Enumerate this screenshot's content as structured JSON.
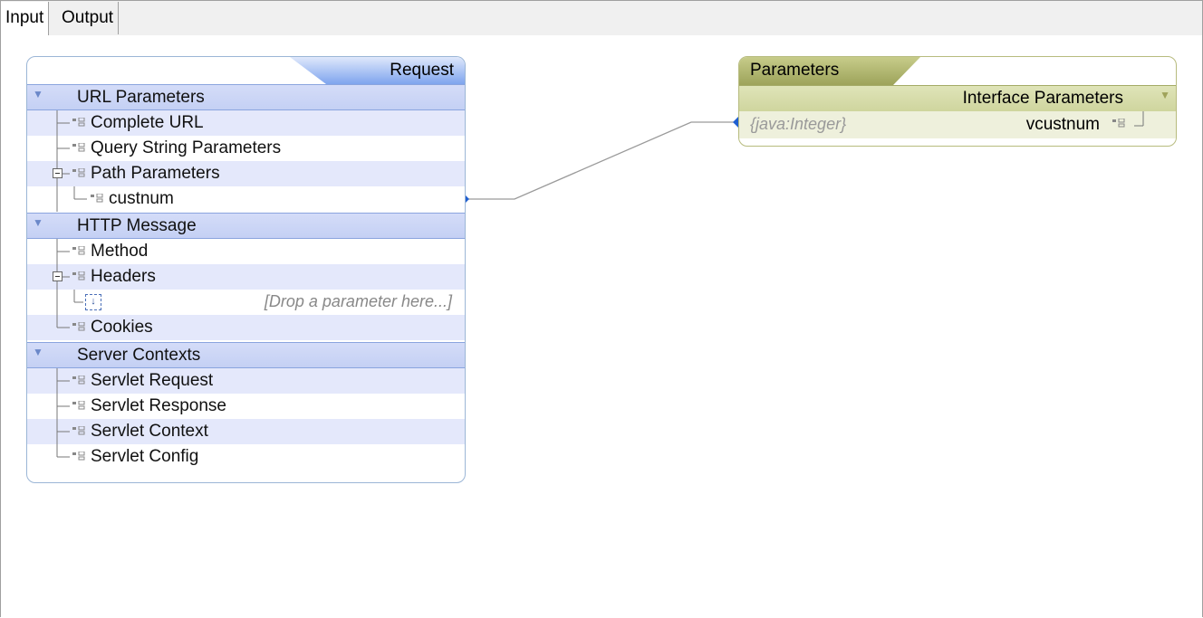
{
  "tabs": [
    {
      "label": "Input"
    },
    {
      "label": "Output"
    }
  ],
  "request": {
    "title": "Request",
    "sections": [
      {
        "label": "URL Parameters",
        "items": [
          {
            "label": "Complete URL"
          },
          {
            "label": "Query String Parameters"
          },
          {
            "label": "Path Parameters",
            "children": [
              {
                "label": "custnum"
              }
            ]
          }
        ]
      },
      {
        "label": "HTTP Message",
        "items": [
          {
            "label": "Method"
          },
          {
            "label": "Headers",
            "drop_hint": "[Drop a parameter here...]"
          },
          {
            "label": "Cookies"
          }
        ]
      },
      {
        "label": "Server Contexts",
        "items": [
          {
            "label": "Servlet Request"
          },
          {
            "label": "Servlet Response"
          },
          {
            "label": "Servlet Context"
          },
          {
            "label": "Servlet Config"
          }
        ]
      }
    ]
  },
  "parameters": {
    "title": "Parameters",
    "group_label": "Interface Parameters",
    "rows": [
      {
        "type": "{java:Integer}",
        "name": "vcustnum"
      }
    ]
  },
  "mapping": {
    "from": "custnum",
    "to": "vcustnum"
  },
  "colors": {
    "request_accent": "#2f6fd8",
    "request_section": "#c9d4f6",
    "parameters_accent": "#a7ab63",
    "connector": "#9a9a9a",
    "port": "#1f5fd0"
  }
}
